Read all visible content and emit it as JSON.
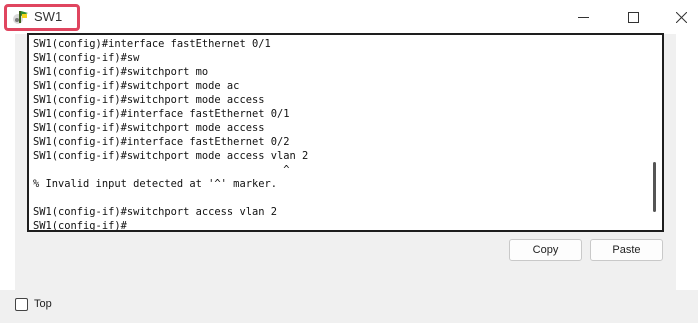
{
  "window": {
    "title": "SW1",
    "icon": "packet-tracer-switch-icon",
    "highlight_color": "#e0455f"
  },
  "terminal": {
    "lines": [
      "SW1(config)#interface fastEthernet 0/1",
      "SW1(config-if)#sw",
      "SW1(config-if)#switchport mo",
      "SW1(config-if)#switchport mode ac",
      "SW1(config-if)#switchport mode access",
      "SW1(config-if)#interface fastEthernet 0/1",
      "SW1(config-if)#switchport mode access",
      "SW1(config-if)#interface fastEthernet 0/2",
      "SW1(config-if)#switchport mode access vlan 2",
      "                                        ^",
      "% Invalid input detected at '^' marker.",
      "",
      "SW1(config-if)#switchport access vlan 2",
      "SW1(config-if)#"
    ]
  },
  "buttons": {
    "copy_label": "Copy",
    "paste_label": "Paste"
  },
  "footer": {
    "top_checkbox_label": "Top",
    "top_checked": false
  }
}
